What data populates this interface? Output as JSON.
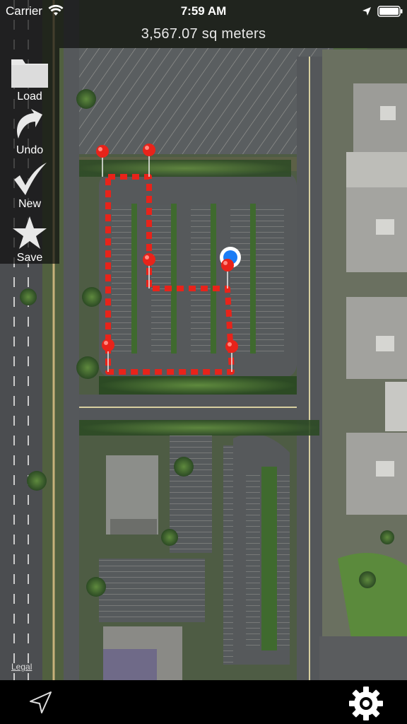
{
  "status_bar": {
    "carrier": "Carrier",
    "time": "7:59 AM"
  },
  "header": {
    "area": "3,567.07 sq meters"
  },
  "toolbar": {
    "items": [
      {
        "label": "Load",
        "icon": "folder-icon"
      },
      {
        "label": "Undo",
        "icon": "undo-arrow-icon"
      },
      {
        "label": "New",
        "icon": "checkmark-icon"
      },
      {
        "label": "Save",
        "icon": "star-icon"
      }
    ]
  },
  "map": {
    "legal_label": "Legal",
    "view": "satellite",
    "polygon_color": "#e8231a"
  },
  "bottom_bar": {
    "left_icon": "navigation-arrow-icon",
    "right_icon": "settings-gear-icon"
  }
}
